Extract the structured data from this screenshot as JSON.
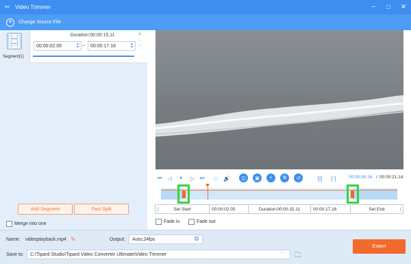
{
  "window": {
    "title": "Video Trimmer",
    "minimize_glyph": "−",
    "maximize_glyph": "□",
    "close_glyph": "✕"
  },
  "toolbar": {
    "change_source_label": "Change Source File"
  },
  "segment": {
    "tab_label": "Segment[1]",
    "duration_text": "Duration:00:00:15.11",
    "start_value": "00:00:02.05",
    "end_value": "00:00:17.16",
    "separator": "–"
  },
  "left_actions": {
    "add_segment_label": "Add Segment",
    "fast_split_label": "Fast Split",
    "merge_label": "Merge into one"
  },
  "player": {
    "current_time": "00:00:04.16",
    "total_time": "00:00:21.14",
    "time_separator": "/",
    "playhead_fraction": 0.197,
    "selection_start_fraction": 0.097,
    "selection_end_fraction": 0.812
  },
  "trim_bar": {
    "set_start_label": "Set Start",
    "start_value": "00:00:02.05",
    "duration_text": "Duration:00:00:15.11",
    "end_value": "00:00:17.16",
    "set_end_label": "Set End"
  },
  "fades": {
    "fade_in_label": "Fade in",
    "fade_out_label": "Fade out"
  },
  "output_settings": {
    "name_label": "Name:",
    "name_value": "videoplayback.mp4",
    "output_label": "Output:",
    "output_value": "Auto;24fps",
    "save_to_label": "Save to:",
    "save_path": "C:\\Tipard Studio\\Tipard Video Converter Ultimate\\Video Trimmer",
    "browse_glyph": "···"
  },
  "export_label": "Export",
  "colors": {
    "accent_blue": "#3d8ef0",
    "accent_orange": "#f26a2c",
    "highlight_green": "#3bd13b"
  }
}
